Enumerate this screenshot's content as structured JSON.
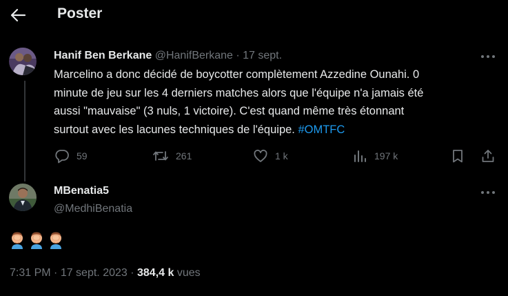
{
  "header": {
    "title": "Poster",
    "back_icon": "arrow-left-icon"
  },
  "parent_tweet": {
    "display_name": "Hanif Ben Berkane",
    "handle": "@HanifBerkane",
    "separator": " · ",
    "date": "17 sept.",
    "text_lines": [
      "Marcelino a donc décidé de boycotter complètement Azzedine Ounahi. 0",
      "minute de jeu sur les 4 derniers matches alors que l'équipe n'a jamais été",
      "aussi \"mauvaise\" (3 nuls, 1 victoire). C'est quand même très étonnant",
      "surtout avec les lacunes techniques de l'équipe. "
    ],
    "hashtag": "#OMTFC",
    "replies": "59",
    "retweets": "261",
    "likes": "1 k",
    "views": "197 k"
  },
  "reply_tweet": {
    "display_name": "MBenatia5",
    "handle": "@MedhiBenatia",
    "emojis": [
      "facepalm",
      "facepalm",
      "facepalm"
    ],
    "time": "7:31 PM",
    "date_separator": " · ",
    "date": "17 sept. 2023",
    "views_separator": " · ",
    "views_count": "384,4 k",
    "views_label": " vues"
  },
  "colors": {
    "background": "#000000",
    "text": "#e7e9ea",
    "secondary": "#71767b",
    "link": "#1d9bf0"
  }
}
